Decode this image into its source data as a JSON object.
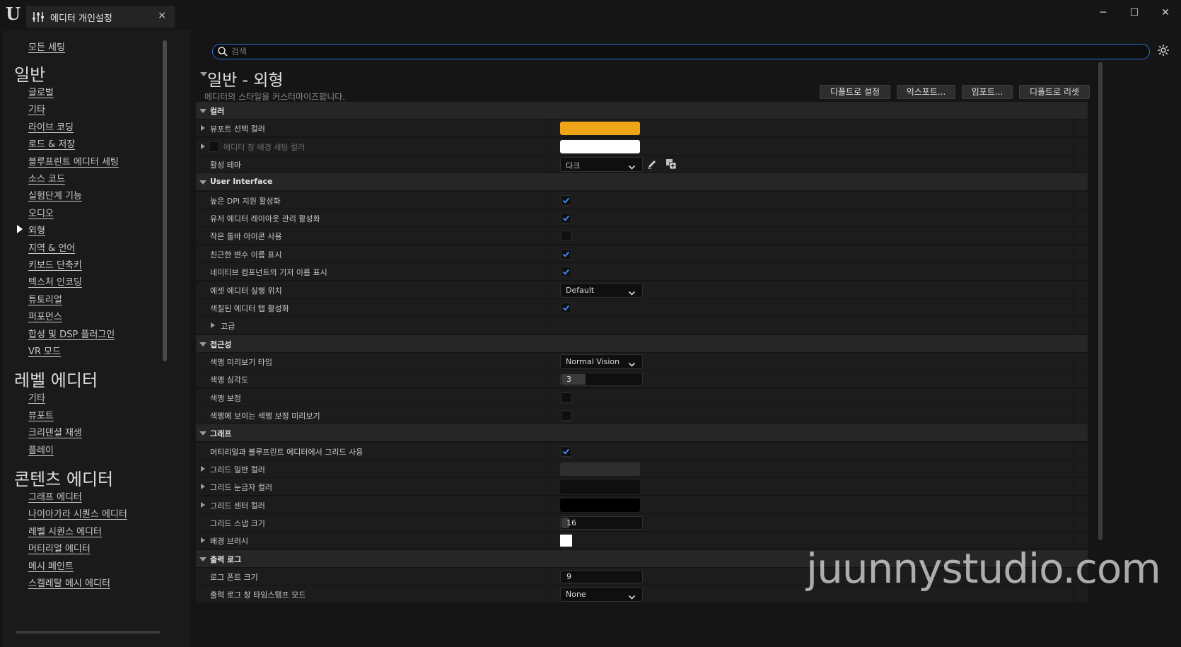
{
  "tab": {
    "title": "에디터 개인설정",
    "close": "×"
  },
  "window": {
    "minimize": "─",
    "maximize": "☐",
    "close": "✕"
  },
  "sidebar": {
    "all_settings": "모든 세팅",
    "sections": [
      {
        "title": "일반",
        "items": [
          "글로벌",
          "기타",
          "라이브 코딩",
          "로드 & 저장",
          "블루프린트 에디터 세팅",
          "소스 코드",
          "실험단계 기능",
          "오디오",
          "외형",
          "지역 & 언어",
          "키보드 단축키",
          "텍스처 인코딩",
          "튜토리얼",
          "퍼포먼스",
          "합성 및 DSP 플러그인",
          "VR 모드"
        ]
      },
      {
        "title": "레벨 에디터",
        "items": [
          "기타",
          "뷰포트",
          "크리덴셜 재생",
          "플레이"
        ]
      },
      {
        "title": "콘텐츠 에디터",
        "items": [
          "그래프 에디터",
          "나이아가라 시퀀스 에디터",
          "레벨 시퀀스 에디터",
          "머티리얼 에디터",
          "메시 페인트",
          "스켈레탈 메시 에디터"
        ]
      }
    ],
    "selected": "외형"
  },
  "search": {
    "placeholder": "검색",
    "value": ""
  },
  "header": {
    "title": "일반 - 외형",
    "subtitle": "에디터의 스타일을 커스터마이즈합니다.",
    "buttons": [
      "디폴트로 설정",
      "익스포트...",
      "임포트...",
      "디폴트로 리셋"
    ]
  },
  "rows": [
    {
      "type": "category",
      "label": "컬러"
    },
    {
      "type": "color",
      "label": "뷰포트 선택 컬러",
      "expandable": true,
      "color": "#f0a418"
    },
    {
      "type": "color",
      "label": "에디터 창 배경 세팅 컬러",
      "expandable": true,
      "color": "#ffffff",
      "dim": true,
      "override_checkbox": true
    },
    {
      "type": "combo",
      "label": "활성 테마",
      "value": "다크",
      "extra_icons": [
        "edit-icon",
        "duplicate-icon"
      ]
    },
    {
      "type": "category",
      "label": "User Interface"
    },
    {
      "type": "check",
      "label": "높은 DPI 지원 활성화",
      "checked": true
    },
    {
      "type": "check",
      "label": "유저 에디터 레이아웃 관리 활성화",
      "checked": true
    },
    {
      "type": "check",
      "label": "작은 툴바 아이콘 사용",
      "checked": false
    },
    {
      "type": "check",
      "label": "친근한 변수 이름 표시",
      "checked": true
    },
    {
      "type": "check",
      "label": "네이티브 컴포넌트의 기저 이름 표시",
      "checked": true
    },
    {
      "type": "combo",
      "label": "에셋 에디터 실행 위치",
      "value": "Default"
    },
    {
      "type": "check",
      "label": "색칠된 에디터 탭 활성화",
      "checked": true
    },
    {
      "type": "advanced",
      "label": "고급"
    },
    {
      "type": "category",
      "label": "접근성"
    },
    {
      "type": "combo",
      "label": "색맹 미리보기 타입",
      "value": "Normal Vision"
    },
    {
      "type": "number",
      "label": "색맹 심각도",
      "value": "3",
      "fill": 0.3
    },
    {
      "type": "check",
      "label": "색맹 보정",
      "checked": false
    },
    {
      "type": "check",
      "label": "색맹에 보이는 색맹 보정 미리보기",
      "checked": false
    },
    {
      "type": "category",
      "label": "그래프"
    },
    {
      "type": "check",
      "label": "머티리얼과 블루프린트 에디터에서 그리드 사용",
      "checked": true
    },
    {
      "type": "color",
      "label": "그리드 일반 컬러",
      "expandable": true,
      "color": "#2e2e2e"
    },
    {
      "type": "color",
      "label": "그리드 눈금자 컬러",
      "expandable": true,
      "color": "#0f0f0f"
    },
    {
      "type": "color",
      "label": "그리드 센터 컬러",
      "expandable": true,
      "color": "#000000"
    },
    {
      "type": "number",
      "label": "그리드 스냅 크기",
      "value": "16",
      "fill": 0.1
    },
    {
      "type": "brush",
      "label": "배경 브러시",
      "expandable": true,
      "color": "#ffffff"
    },
    {
      "type": "category",
      "label": "출력 로그"
    },
    {
      "type": "number",
      "label": "로그 폰트 크기",
      "value": "9",
      "fill": 0
    },
    {
      "type": "combo",
      "label": "출력 로그 창 타임스탬프 모드",
      "value": "None"
    }
  ],
  "watermark": "juunnystudio.com"
}
